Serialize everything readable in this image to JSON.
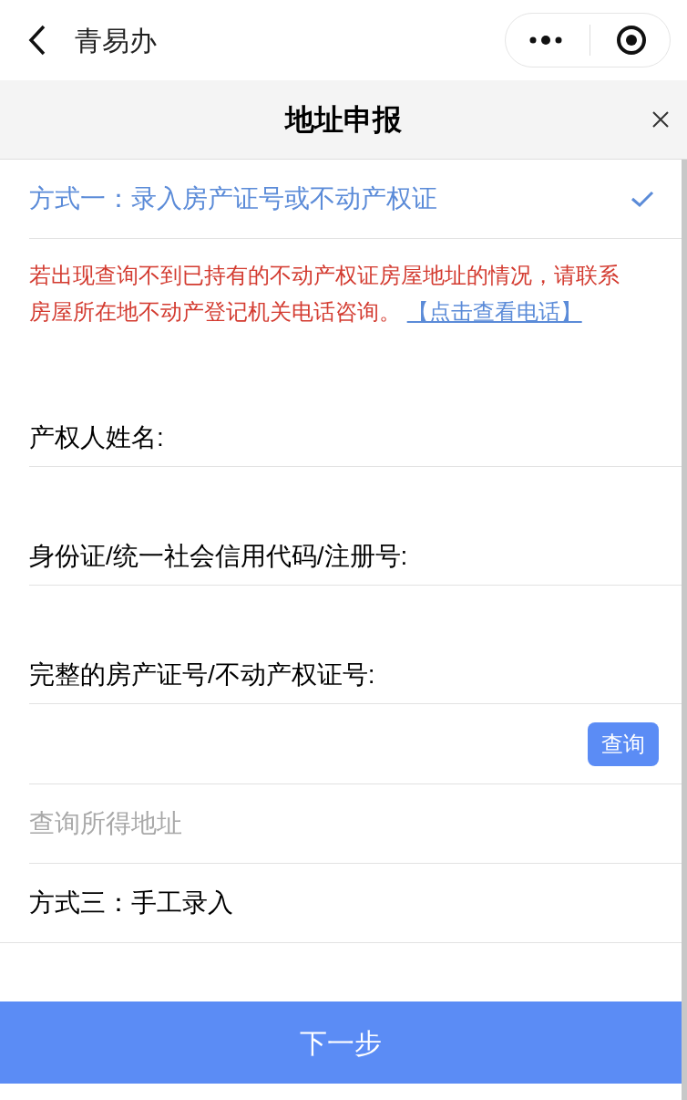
{
  "nav": {
    "title": "青易办"
  },
  "header": {
    "title": "地址申报"
  },
  "method_one": {
    "label": "方式一：录入房产证号或不动产权证",
    "selected": true
  },
  "notice": {
    "text": "若出现查询不到已持有的不动产权证房屋地址的情况，请联系房屋所在地不动产登记机关电话咨询。",
    "link": "【点击查看电话】"
  },
  "fields": [
    {
      "label": "产权人姓名:"
    },
    {
      "label": "身份证/统一社会信用代码/注册号:"
    },
    {
      "label": "完整的房产证号/不动产权证号:"
    }
  ],
  "query_button": "查询",
  "address": {
    "placeholder": "查询所得地址"
  },
  "method_three": {
    "label": "方式三：手工录入",
    "selected": false
  },
  "next_button": "下一步"
}
